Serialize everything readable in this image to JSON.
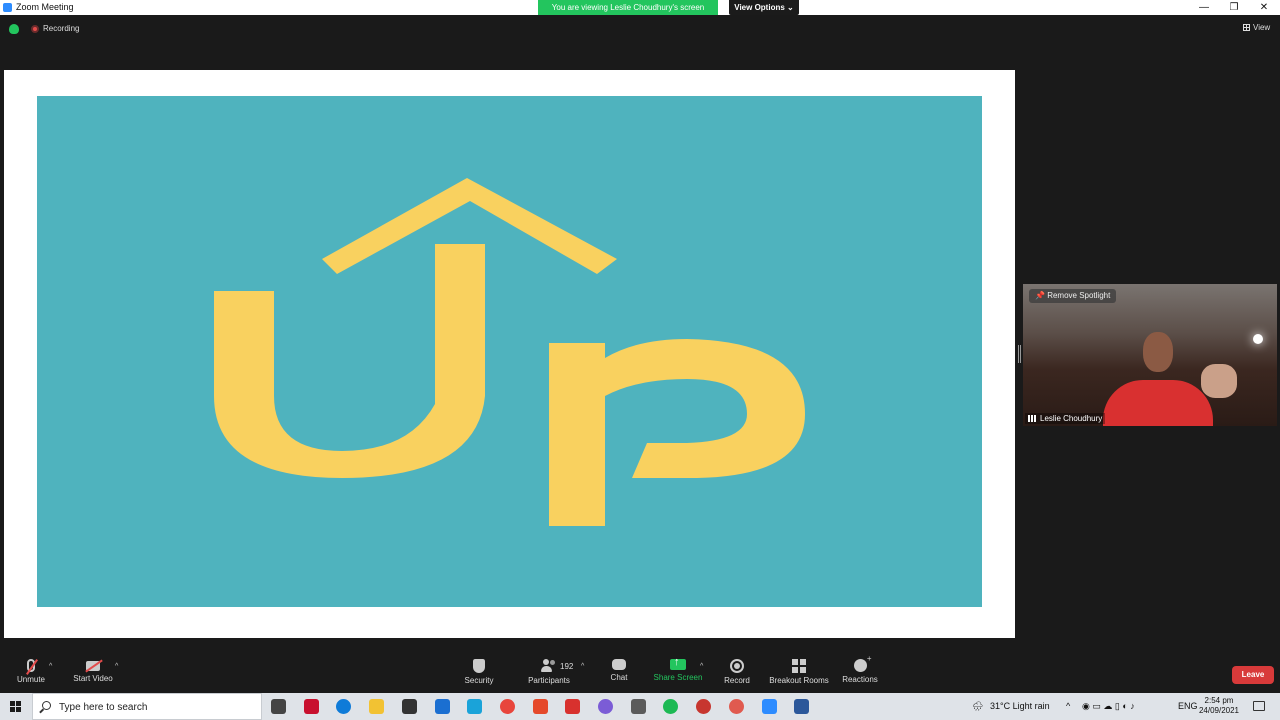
{
  "window": {
    "title": "Zoom Meeting",
    "banner": "You are viewing Leslie Choudhury's screen",
    "view_options": "View Options ⌄",
    "minimize": "—",
    "restore": "❐",
    "close": "✕"
  },
  "status": {
    "recording": "Recording",
    "view": "View"
  },
  "video": {
    "remove_spotlight": "Remove Spotlight",
    "participant_name": "Leslie Choudhury"
  },
  "toolbar": {
    "unmute": "Unmute",
    "start_video": "Start Video",
    "security": "Security",
    "participants": "Participants",
    "participants_count": "192",
    "chat": "Chat",
    "share_screen": "Share Screen",
    "record": "Record",
    "breakout_rooms": "Breakout Rooms",
    "reactions": "Reactions",
    "leave": "Leave"
  },
  "taskbar": {
    "search_placeholder": "Type here to search",
    "weather": "31°C  Light rain",
    "language": "ENG",
    "time": "2:54 pm",
    "date": "24/09/2021",
    "apps": [
      {
        "name": "task-view",
        "color": "#444444"
      },
      {
        "name": "mcafee",
        "color": "#c8102e"
      },
      {
        "name": "edge",
        "color": "#0f7bd8"
      },
      {
        "name": "file-explorer",
        "color": "#f2c233"
      },
      {
        "name": "store",
        "color": "#333333"
      },
      {
        "name": "mail",
        "color": "#1b6fd1"
      },
      {
        "name": "lens",
        "color": "#1aa3d9"
      },
      {
        "name": "chrome",
        "color": "#e8453c"
      },
      {
        "name": "office",
        "color": "#e5492a"
      },
      {
        "name": "app-red",
        "color": "#d8312e"
      },
      {
        "name": "viber",
        "color": "#7b5cd6"
      },
      {
        "name": "calculator",
        "color": "#5b5b5b"
      },
      {
        "name": "spotify",
        "color": "#1db954"
      },
      {
        "name": "chrome-profile",
        "color": "#c7362f"
      },
      {
        "name": "chrome-2",
        "color": "#e05a4f"
      },
      {
        "name": "zoom",
        "color": "#2d8cff"
      },
      {
        "name": "word",
        "color": "#2b579a"
      }
    ]
  },
  "slide": {
    "background": "#4fb3be",
    "logo_color": "#f9d15f"
  }
}
